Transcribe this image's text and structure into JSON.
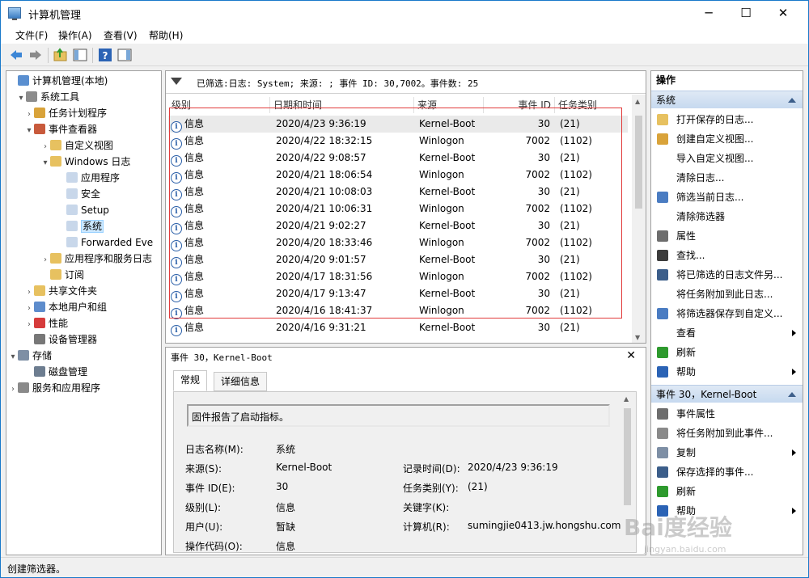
{
  "window": {
    "title": "计算机管理",
    "minimize": "─",
    "maximize": "☐",
    "close": "✕"
  },
  "menu": [
    "文件(F)",
    "操作(A)",
    "查看(V)",
    "帮助(H)"
  ],
  "tree": [
    {
      "label": "计算机管理(本地)",
      "exp": "",
      "icon": "computer-icon",
      "sel": false
    },
    {
      "label": "系统工具",
      "exp": "▾",
      "icon": "tools-icon",
      "sel": false
    },
    {
      "label": "任务计划程序",
      "exp": "›",
      "icon": "clock-icon",
      "sel": false
    },
    {
      "label": "事件查看器",
      "exp": "▾",
      "icon": "event-viewer-icon",
      "sel": false
    },
    {
      "label": "自定义视图",
      "exp": "›",
      "icon": "folder-icon",
      "sel": false
    },
    {
      "label": "Windows 日志",
      "exp": "▾",
      "icon": "folder-icon",
      "sel": false
    },
    {
      "label": "应用程序",
      "exp": "",
      "icon": "log-icon",
      "sel": false
    },
    {
      "label": "安全",
      "exp": "",
      "icon": "log-icon",
      "sel": false
    },
    {
      "label": "Setup",
      "exp": "",
      "icon": "log-icon",
      "sel": false
    },
    {
      "label": "系统",
      "exp": "",
      "icon": "log-icon",
      "sel": true
    },
    {
      "label": "Forwarded Eve",
      "exp": "",
      "icon": "log-icon",
      "sel": false
    },
    {
      "label": "应用程序和服务日志",
      "exp": "›",
      "icon": "folder-icon",
      "sel": false
    },
    {
      "label": "订阅",
      "exp": "",
      "icon": "subscription-icon",
      "sel": false
    },
    {
      "label": "共享文件夹",
      "exp": "›",
      "icon": "shared-folder-icon",
      "sel": false
    },
    {
      "label": "本地用户和组",
      "exp": "›",
      "icon": "users-icon",
      "sel": false
    },
    {
      "label": "性能",
      "exp": "›",
      "icon": "performance-icon",
      "sel": false
    },
    {
      "label": "设备管理器",
      "exp": "",
      "icon": "device-manager-icon",
      "sel": false
    },
    {
      "label": "存储",
      "exp": "▾",
      "icon": "storage-icon",
      "sel": false
    },
    {
      "label": "磁盘管理",
      "exp": "",
      "icon": "disk-icon",
      "sel": false
    },
    {
      "label": "服务和应用程序",
      "exp": "›",
      "icon": "services-icon",
      "sel": false
    }
  ],
  "filter_text": "已筛选:日志: System; 来源: ; 事件 ID: 30,7002。事件数: 25",
  "columns": [
    "级别",
    "日期和时间",
    "来源",
    "事件 ID",
    "任务类别"
  ],
  "events": [
    {
      "level": "信息",
      "datetime": "2020/4/23 9:36:19",
      "source": "Kernel-Boot",
      "id": "30",
      "task": "(21)"
    },
    {
      "level": "信息",
      "datetime": "2020/4/22 18:32:15",
      "source": "Winlogon",
      "id": "7002",
      "task": "(1102)"
    },
    {
      "level": "信息",
      "datetime": "2020/4/22 9:08:57",
      "source": "Kernel-Boot",
      "id": "30",
      "task": "(21)"
    },
    {
      "level": "信息",
      "datetime": "2020/4/21 18:06:54",
      "source": "Winlogon",
      "id": "7002",
      "task": "(1102)"
    },
    {
      "level": "信息",
      "datetime": "2020/4/21 10:08:03",
      "source": "Kernel-Boot",
      "id": "30",
      "task": "(21)"
    },
    {
      "level": "信息",
      "datetime": "2020/4/21 10:06:31",
      "source": "Winlogon",
      "id": "7002",
      "task": "(1102)"
    },
    {
      "level": "信息",
      "datetime": "2020/4/21 9:02:27",
      "source": "Kernel-Boot",
      "id": "30",
      "task": "(21)"
    },
    {
      "level": "信息",
      "datetime": "2020/4/20 18:33:46",
      "source": "Winlogon",
      "id": "7002",
      "task": "(1102)"
    },
    {
      "level": "信息",
      "datetime": "2020/4/20 9:01:57",
      "source": "Kernel-Boot",
      "id": "30",
      "task": "(21)"
    },
    {
      "level": "信息",
      "datetime": "2020/4/17 18:31:56",
      "source": "Winlogon",
      "id": "7002",
      "task": "(1102)"
    },
    {
      "level": "信息",
      "datetime": "2020/4/17 9:13:47",
      "source": "Kernel-Boot",
      "id": "30",
      "task": "(21)"
    },
    {
      "level": "信息",
      "datetime": "2020/4/16 18:41:37",
      "source": "Winlogon",
      "id": "7002",
      "task": "(1102)"
    },
    {
      "level": "信息",
      "datetime": "2020/4/16 9:31:21",
      "source": "Kernel-Boot",
      "id": "30",
      "task": "(21)"
    }
  ],
  "detail": {
    "title": "事件 30，Kernel-Boot",
    "tabs": [
      "常规",
      "详细信息"
    ],
    "message": "固件报告了启动指标。",
    "fields": {
      "log_name_label": "日志名称(M):",
      "log_name": "系统",
      "source_label": "来源(S):",
      "source": "Kernel-Boot",
      "recorded_label": "记录时间(D):",
      "recorded": "2020/4/23 9:36:19",
      "event_id_label": "事件 ID(E):",
      "event_id": "30",
      "task_label": "任务类别(Y):",
      "task": "(21)",
      "level_label": "级别(L):",
      "level": "信息",
      "keywords_label": "关键字(K):",
      "user_label": "用户(U):",
      "user": "暂缺",
      "computer_label": "计算机(R):",
      "computer": "sumingjie0413.jw.hongshu.com",
      "opcode_label": "操作代码(O):",
      "opcode": "信息"
    }
  },
  "actions": {
    "header": "操作",
    "section1": "系统",
    "section1_items": [
      {
        "label": "打开保存的日志...",
        "icon": "open-folder-icon",
        "sub": false
      },
      {
        "label": "创建自定义视图...",
        "icon": "filter-create-icon",
        "sub": false
      },
      {
        "label": "导入自定义视图...",
        "icon": "",
        "sub": false
      },
      {
        "label": "清除日志...",
        "icon": "",
        "sub": false
      },
      {
        "label": "筛选当前日志...",
        "icon": "filter-icon",
        "sub": false
      },
      {
        "label": "清除筛选器",
        "icon": "",
        "sub": false
      },
      {
        "label": "属性",
        "icon": "properties-icon",
        "sub": false
      },
      {
        "label": "查找...",
        "icon": "find-icon",
        "sub": false
      },
      {
        "label": "将已筛选的日志文件另...",
        "icon": "save-icon",
        "sub": false
      },
      {
        "label": "将任务附加到此日志...",
        "icon": "",
        "sub": false
      },
      {
        "label": "将筛选器保存到自定义...",
        "icon": "filter-save-icon",
        "sub": false
      },
      {
        "label": "查看",
        "icon": "",
        "sub": true
      },
      {
        "label": "刷新",
        "icon": "refresh-icon",
        "sub": false
      },
      {
        "label": "帮助",
        "icon": "help-icon",
        "sub": true
      }
    ],
    "section2": "事件 30，Kernel-Boot",
    "section2_items": [
      {
        "label": "事件属性",
        "icon": "properties-icon",
        "sub": false
      },
      {
        "label": "将任务附加到此事件...",
        "icon": "task-icon",
        "sub": false
      },
      {
        "label": "复制",
        "icon": "copy-icon",
        "sub": true
      },
      {
        "label": "保存选择的事件...",
        "icon": "save-icon",
        "sub": false
      },
      {
        "label": "刷新",
        "icon": "refresh-icon",
        "sub": false
      },
      {
        "label": "帮助",
        "icon": "help-icon",
        "sub": true
      }
    ]
  },
  "status": "创建筛选器。",
  "watermark": {
    "brand": "Bai度经验",
    "url": "jingyan.baidu.com"
  }
}
